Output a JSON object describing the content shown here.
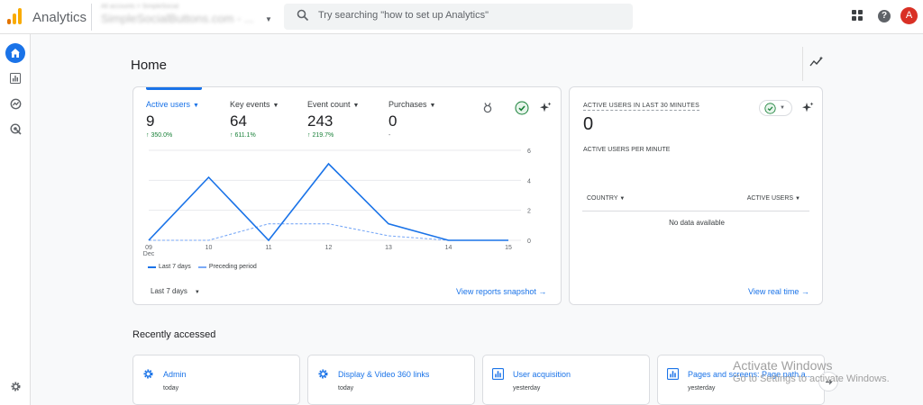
{
  "app": {
    "title": "Analytics",
    "account_label": "All accounts > SimpleSocial",
    "property_name": "SimpleSocialButtons.com - ...",
    "avatar_letter": "A",
    "colors": {
      "accent": "#1a73e8",
      "success": "#188038",
      "avatar": "#d93025"
    }
  },
  "search": {
    "placeholder": "Try searching \"how to set up Analytics\""
  },
  "page": {
    "title": "Home"
  },
  "overview": {
    "metrics": [
      {
        "label": "Active users",
        "value": "9",
        "change": "↑ 350.0%"
      },
      {
        "label": "Key events",
        "value": "64",
        "change": "↑ 611.1%"
      },
      {
        "label": "Event count",
        "value": "243",
        "change": "↑ 219.7%"
      },
      {
        "label": "Purchases",
        "value": "0",
        "change": "-"
      }
    ],
    "legend": {
      "current": "Last 7 days",
      "previous": "Preceding period"
    },
    "date_range": "Last 7 days",
    "link": "View reports snapshot →"
  },
  "chart_data": {
    "type": "line",
    "x": [
      "09",
      "10",
      "11",
      "12",
      "13",
      "14",
      "15"
    ],
    "x_sublabel": "Dec",
    "y_ticks": [
      0,
      2,
      4,
      6
    ],
    "ylim": [
      0,
      6
    ],
    "series": [
      {
        "name": "Last 7 days",
        "values": [
          0,
          4.2,
          0,
          5.1,
          1.1,
          0,
          0
        ]
      },
      {
        "name": "Preceding period",
        "values": [
          0,
          0,
          1.1,
          1.1,
          0.3,
          0,
          0
        ]
      }
    ]
  },
  "realtime": {
    "title": "ACTIVE USERS IN LAST 30 MINUTES",
    "value": "0",
    "per_minute_label": "ACTIVE USERS PER MINUTE",
    "col_country": "COUNTRY",
    "col_active_users": "ACTIVE USERS",
    "empty": "No data available",
    "link": "View real time →"
  },
  "recent": {
    "title": "Recently accessed",
    "items": [
      {
        "title": "Admin",
        "subtitle": "today",
        "icon": "gear-icon"
      },
      {
        "title": "Display & Video 360 links",
        "subtitle": "today",
        "icon": "gear-icon"
      },
      {
        "title": "User acquisition",
        "subtitle": "yesterday",
        "icon": "report-icon"
      },
      {
        "title": "Pages and screens: Page path a...",
        "subtitle": "yesterday",
        "icon": "report-icon"
      }
    ]
  },
  "watermark": {
    "line1": "Activate Windows",
    "line2": "Go to Settings to activate Windows."
  }
}
